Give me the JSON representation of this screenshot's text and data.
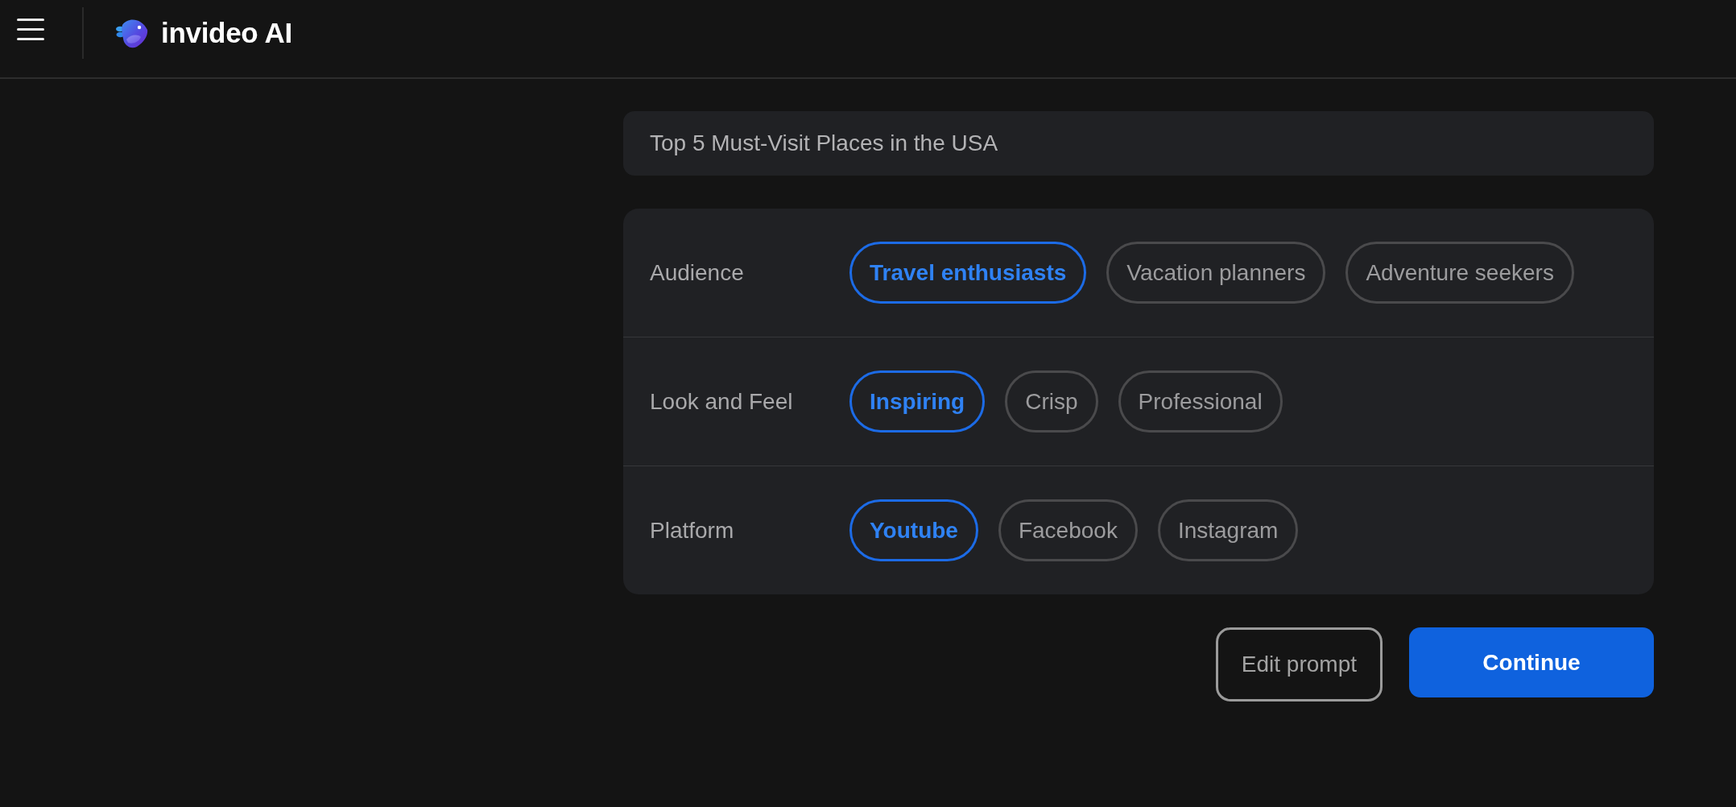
{
  "header": {
    "brand": "invideo AI"
  },
  "prompt": {
    "text": "Top 5 Must-Visit Places in the USA"
  },
  "options": [
    {
      "label": "Audience",
      "choices": [
        {
          "label": "Travel enthusiasts",
          "selected": true
        },
        {
          "label": "Vacation planners",
          "selected": false
        },
        {
          "label": "Adventure seekers",
          "selected": false
        }
      ]
    },
    {
      "label": "Look and Feel",
      "choices": [
        {
          "label": "Inspiring",
          "selected": true
        },
        {
          "label": "Crisp",
          "selected": false
        },
        {
          "label": "Professional",
          "selected": false
        }
      ]
    },
    {
      "label": "Platform",
      "choices": [
        {
          "label": "Youtube",
          "selected": true
        },
        {
          "label": "Facebook",
          "selected": false
        },
        {
          "label": "Instagram",
          "selected": false
        }
      ]
    }
  ],
  "buttons": [
    {
      "label": "Edit prompt",
      "kind": "secondary"
    },
    {
      "label": "Continue",
      "kind": "primary"
    }
  ]
}
